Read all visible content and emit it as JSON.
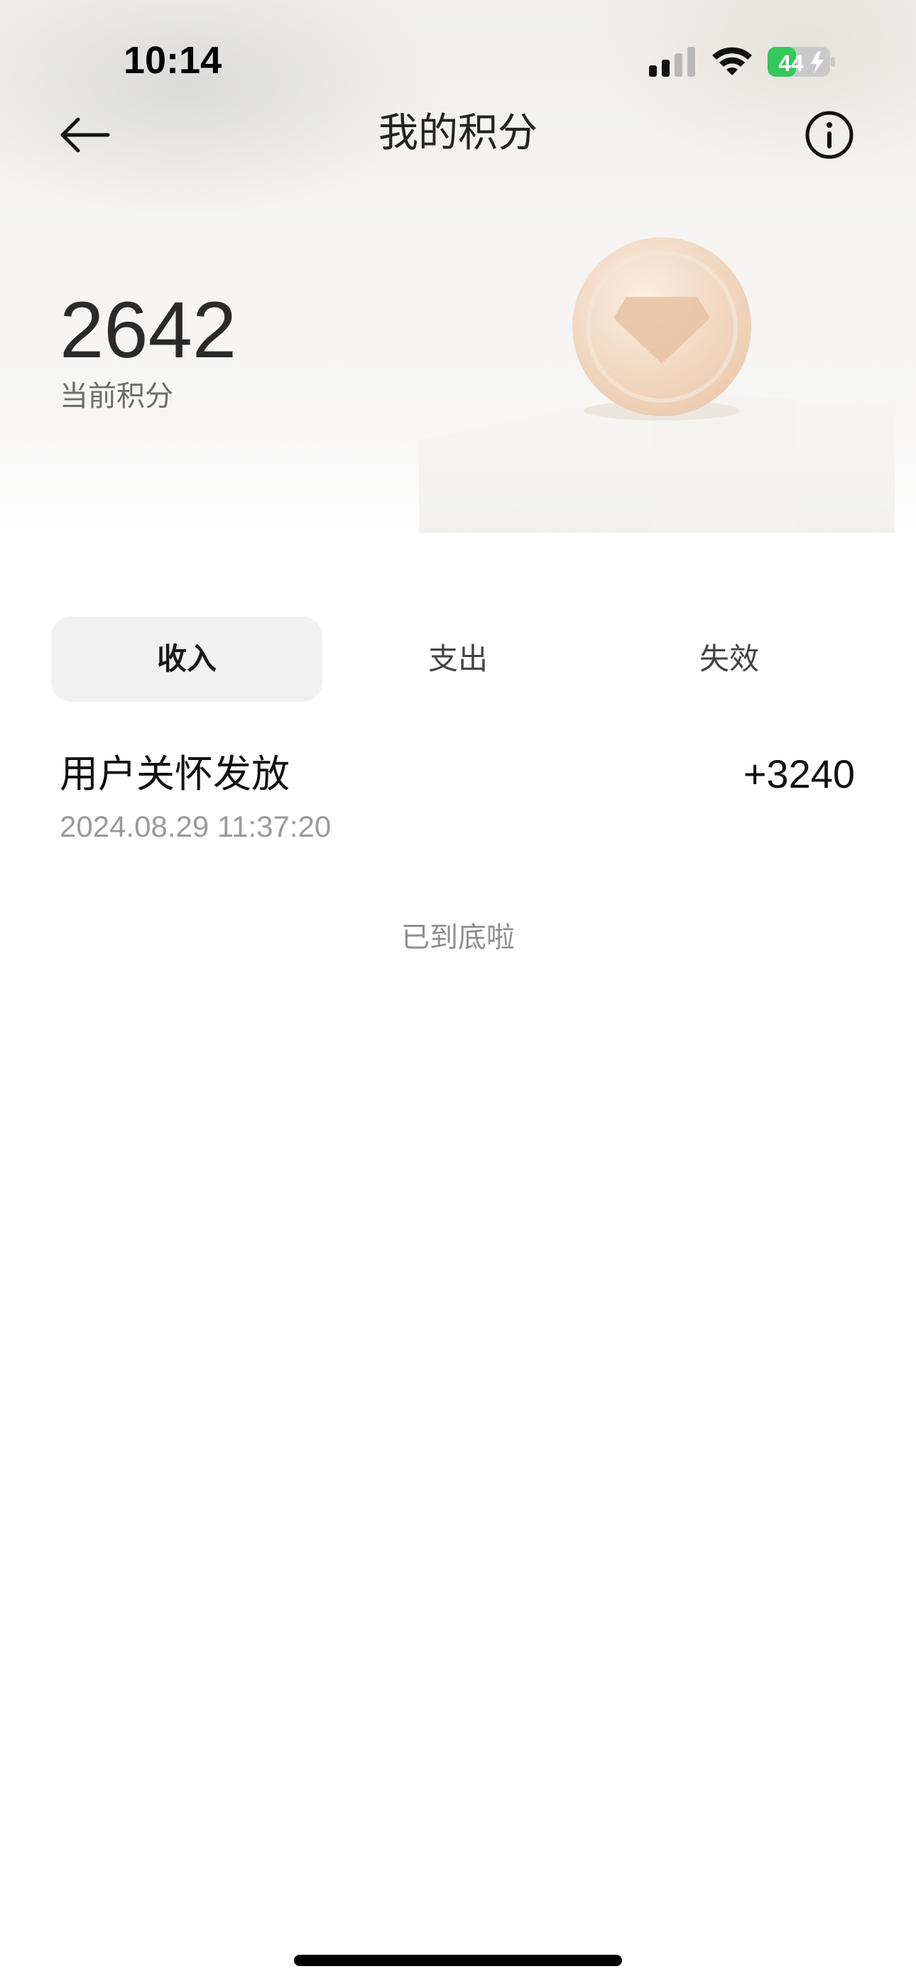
{
  "status_bar": {
    "time": "10:14",
    "battery": "44",
    "icons": [
      "signal-icon",
      "wifi-icon",
      "battery-charging-icon"
    ]
  },
  "header": {
    "title": "我的积分",
    "back_icon": "arrow-left-icon",
    "info_icon": "info-circle-icon"
  },
  "points": {
    "value": "2642",
    "label": "当前积分"
  },
  "tabs": [
    {
      "label": "收入",
      "active": true
    },
    {
      "label": "支出",
      "active": false
    },
    {
      "label": "失效",
      "active": false
    }
  ],
  "records": [
    {
      "title": "用户关怀发放",
      "amount": "+3240",
      "time": "2024.08.29 11:37:20"
    }
  ],
  "footer": {
    "end_text": "已到底啦"
  },
  "colors": {
    "battery_green": "#34c759",
    "active_tab_bg": "#f1f1f1",
    "coin": "#f3dcc6"
  }
}
